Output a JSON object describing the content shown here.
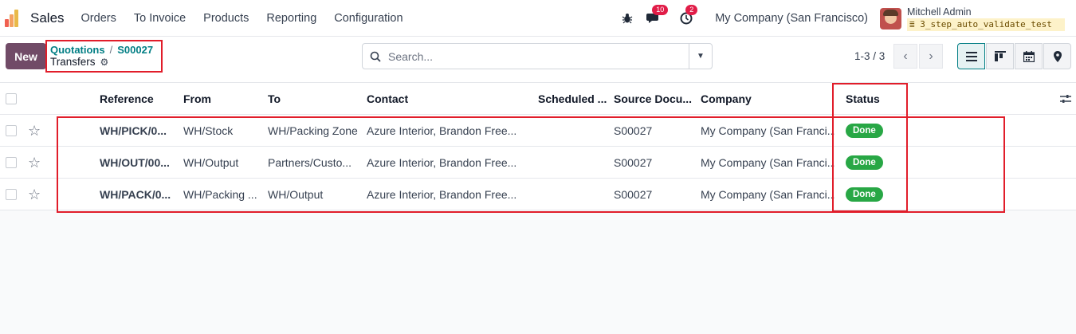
{
  "navbar": {
    "app_name": "Sales",
    "menu": [
      "Orders",
      "To Invoice",
      "Products",
      "Reporting",
      "Configuration"
    ],
    "chat_count": "10",
    "activity_count": "2",
    "company": "My Company (San Francisco)",
    "user_name": "Mitchell Admin",
    "database": "3_step_auto_validate_test"
  },
  "control": {
    "new_label": "New",
    "breadcrumb": [
      "Quotations",
      "S00027"
    ],
    "current_view": "Transfers",
    "search_placeholder": "Search...",
    "pager": "1-3 / 3"
  },
  "table": {
    "columns": [
      "Reference",
      "From",
      "To",
      "Contact",
      "Scheduled ...",
      "Source Docu...",
      "Company",
      "Status"
    ],
    "rows": [
      {
        "reference": "WH/PICK/0...",
        "from": "WH/Stock",
        "to": "WH/Packing Zone",
        "contact": "Azure Interior, Brandon Free...",
        "scheduled": "",
        "source": "S00027",
        "company": "My Company (San Franci...",
        "status": "Done"
      },
      {
        "reference": "WH/OUT/00...",
        "from": "WH/Output",
        "to": "Partners/Custo...",
        "contact": "Azure Interior, Brandon Free...",
        "scheduled": "",
        "source": "S00027",
        "company": "My Company (San Franci...",
        "status": "Done"
      },
      {
        "reference": "WH/PACK/0...",
        "from": "WH/Packing ...",
        "to": "WH/Output",
        "contact": "Azure Interior, Brandon Free...",
        "scheduled": "",
        "source": "S00027",
        "company": "My Company (San Franci...",
        "status": "Done"
      }
    ]
  },
  "colors": {
    "brand": "#714b67",
    "link": "#017e84",
    "done": "#28a745",
    "highlight": "#e11d2a"
  }
}
